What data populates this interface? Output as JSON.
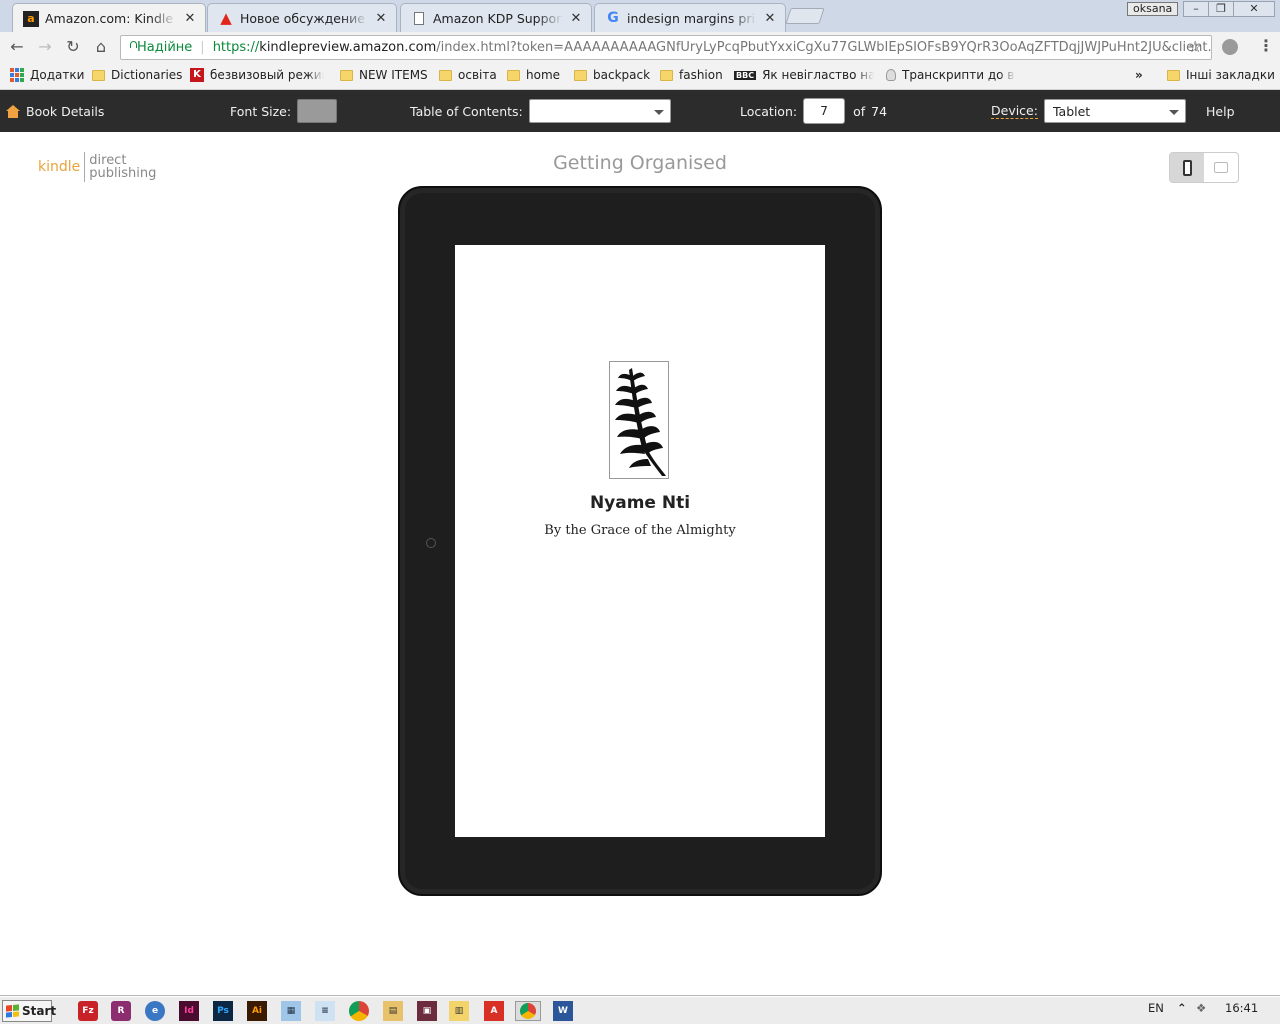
{
  "tabs": [
    {
      "title": "Amazon.com: Kindle Dire",
      "favicon": "amazon-icon",
      "active": true
    },
    {
      "title": "Новое обсуждение | Ad",
      "favicon": "adobe-icon",
      "active": false
    },
    {
      "title": "Amazon KDP Support: Ki",
      "favicon": "page-icon",
      "active": false
    },
    {
      "title": "indesign margins printin",
      "favicon": "google-icon",
      "active": false
    }
  ],
  "user_badge": "oksana",
  "address": {
    "secure_label": "Надійне",
    "scheme": "https://",
    "host": "kindlepreview.amazon.com",
    "rest": "/index.html?token=AAAAAAAAAAGNfUryLyPcqPbutYxxiCgXu77GLWbIEpSIOFsB9YQrR3OoAqZFTDqjJWJPuHnt2JU&client..."
  },
  "bookmarks": [
    {
      "label": "Додатки",
      "icon": "apps-grid-icon"
    },
    {
      "label": "Dictionaries",
      "icon": "folder-icon"
    },
    {
      "label": "безвизовый режим.",
      "icon": "k-icon"
    },
    {
      "label": "NEW ITEMS",
      "icon": "folder-icon"
    },
    {
      "label": "освіта",
      "icon": "folder-icon"
    },
    {
      "label": "home",
      "icon": "folder-icon"
    },
    {
      "label": "backpack",
      "icon": "folder-icon"
    },
    {
      "label": "fashion",
      "icon": "folder-icon"
    },
    {
      "label": "Як невігластво навм",
      "icon": "bbc-icon"
    },
    {
      "label": "Транскрипти до віде",
      "icon": "bulb-icon"
    },
    {
      "label": "Інші закладки",
      "icon": "folder-icon"
    }
  ],
  "bookmarks_overflow": "»",
  "kdp_toolbar": {
    "book_details": "Book Details",
    "font_size_label": "Font Size:",
    "toc_label": "Table of Contents:",
    "toc_value": "",
    "location_label": "Location:",
    "location_value": "7",
    "location_of": "of",
    "location_total": "74",
    "device_label": "Device:",
    "device_value": "Tablet",
    "help": "Help"
  },
  "logo": {
    "kindle": "kindle",
    "direct": "direct",
    "publishing": "publishing"
  },
  "page_title": "Getting Organised",
  "book": {
    "title": "Nyame Nti",
    "subtitle": "By the Grace of the Almighty"
  },
  "taskbar": {
    "start": "Start",
    "apps": [
      "filezilla-icon",
      "winrar-icon",
      "browser-icon",
      "indesign-icon",
      "photoshop-icon",
      "illustrator-icon",
      "calculator-icon",
      "notepad-icon",
      "chrome-icon",
      "explorer-icon",
      "media-icon",
      "files-icon",
      "pdf-icon",
      "chrome-active-icon",
      "word-icon"
    ],
    "lang": "EN",
    "clock": "16:41"
  },
  "colors": {
    "kdp_bar": "#2c2c2c",
    "kindle_orange": "#e8a33c",
    "device_frame": "#1e1e1e",
    "secure_green": "#0a8a3a"
  }
}
